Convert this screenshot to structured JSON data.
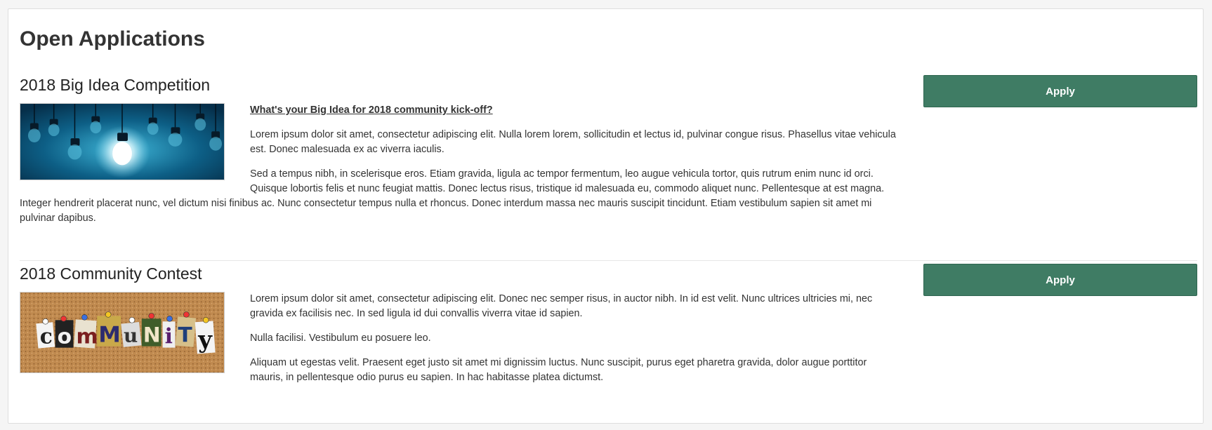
{
  "page": {
    "title": "Open Applications"
  },
  "applications": [
    {
      "title": "2018 Big Idea Competition",
      "apply_label": "Apply",
      "image_icon": "lightbulbs-image",
      "intro": "What's your Big Idea for 2018 community kick-off?",
      "paragraphs": [
        "Lorem ipsum dolor sit amet, consectetur adipiscing elit. Nulla lorem lorem, sollicitudin et lectus id, pulvinar congue risus. Phasellus vitae vehicula est. Donec malesuada ex ac viverra iaculis.",
        "Sed a tempus nibh, in scelerisque eros. Etiam gravida, ligula ac tempor fermentum, leo augue vehicula tortor, quis rutrum enim nunc id orci. Quisque lobortis felis et nunc feugiat mattis. Donec lectus risus, tristique id malesuada eu, commodo aliquet nunc. Pellentesque at est magna. Integer hendrerit placerat nunc, vel dictum nisi finibus ac. Nunc consectetur tempus nulla et rhoncus. Donec interdum massa nec mauris suscipit tincidunt. Etiam vestibulum sapien sit amet mi pulvinar dapibus."
      ]
    },
    {
      "title": "2018 Community Contest",
      "apply_label": "Apply",
      "image_icon": "community-letters-image",
      "image_letters": [
        "c",
        "o",
        "m",
        "M",
        "u",
        "N",
        "i",
        "T",
        "y"
      ],
      "paragraphs": [
        "Lorem ipsum dolor sit amet, consectetur adipiscing elit. Donec nec semper risus, in auctor nibh. In id est velit. Nunc ultrices ultricies mi, nec gravida ex facilisis nec. In sed ligula id dui convallis viverra vitae id sapien.",
        "Nulla facilisi. Vestibulum eu posuere leo.",
        "Aliquam ut egestas velit. Praesent eget justo sit amet mi dignissim luctus. Nunc suscipit, purus eget pharetra gravida, dolor augue porttitor mauris, in pellentesque odio purus eu sapien. In hac habitasse platea dictumst."
      ]
    }
  ],
  "colors": {
    "apply_button": "#3f7c64",
    "apply_text": "#ffffff",
    "divider": "#e6e6e6"
  }
}
